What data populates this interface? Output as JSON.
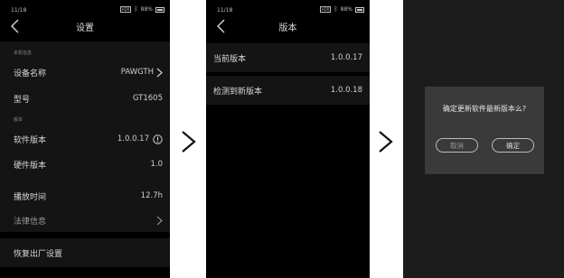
{
  "status": {
    "time": "11/18",
    "hdr_badge": "HDR",
    "battery": "88%"
  },
  "screen1": {
    "title": "设置",
    "section_device": "本机信息",
    "device_name_label": "设备名称",
    "device_name_value": "PAWGTH",
    "model_label": "型号",
    "model_value": "GT1605",
    "section_version": "版本",
    "software_version_label": "软件版本",
    "software_version_value": "1.0.0.17",
    "hardware_version_label": "硬件版本",
    "hardware_version_value": "1.0",
    "play_time_label": "播放时间",
    "play_time_value": "12.7h",
    "legal_label": "法律信息",
    "restore_label": "恢复出厂设置"
  },
  "screen2": {
    "title": "版本",
    "current_version_label": "当前版本",
    "current_version_value": "1.0.0.17",
    "new_version_label": "检测到新版本",
    "new_version_value": "1.0.0.18"
  },
  "screen3": {
    "dialog_message": "确定更新软件最新版本么?",
    "cancel_label": "取消",
    "confirm_label": "确定"
  },
  "icons": [
    "back-icon",
    "chevron-right-icon",
    "info-icon",
    "bluetooth-icon",
    "battery-icon",
    "next-arrow-icon"
  ],
  "colors": {
    "background": "#000000",
    "row_background": "#141414",
    "dialog_background": "#3a3a3a",
    "text": "#d8d8d8"
  }
}
